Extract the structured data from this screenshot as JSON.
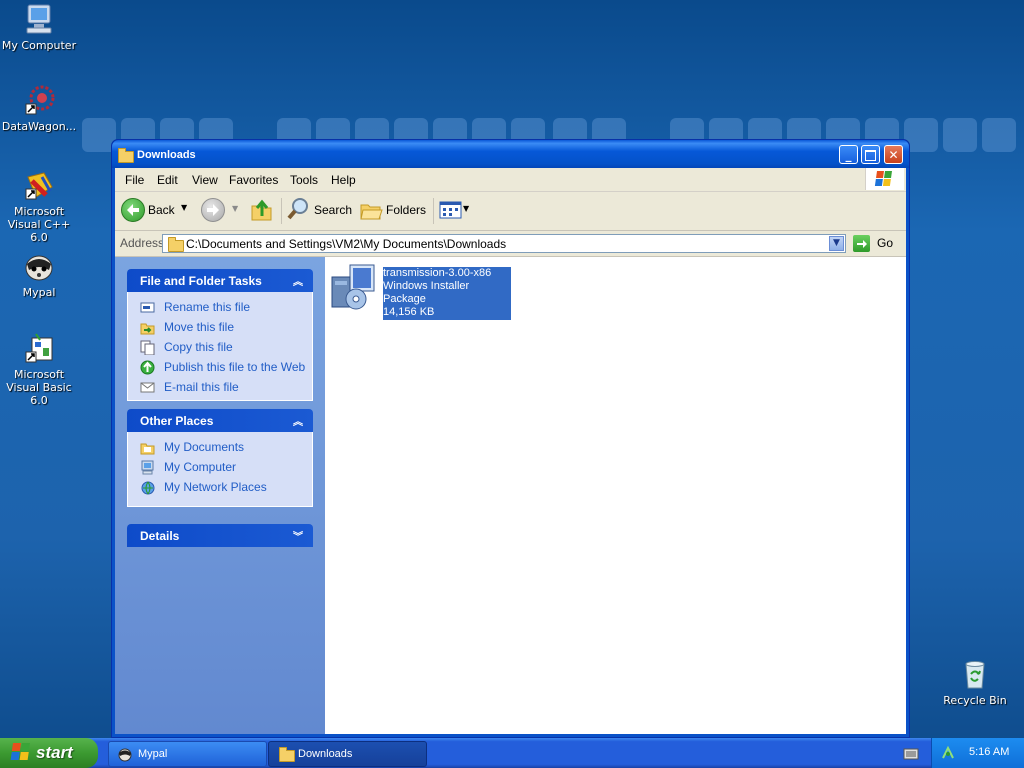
{
  "desktop": {
    "icons": [
      {
        "label": "My Computer"
      },
      {
        "label": "DataWagon..."
      },
      {
        "label": "Microsoft Visual C++ 6.0"
      },
      {
        "label": "Mypal"
      },
      {
        "label": "Microsoft Visual Basic 6.0"
      },
      {
        "label": "Recycle Bin"
      }
    ]
  },
  "window": {
    "title": "Downloads",
    "menu": [
      "File",
      "Edit",
      "View",
      "Favorites",
      "Tools",
      "Help"
    ],
    "toolbar": {
      "back": "Back",
      "search": "Search",
      "folders": "Folders"
    },
    "address": {
      "label": "Address",
      "value": "C:\\Documents and Settings\\VM2\\My Documents\\Downloads",
      "go": "Go"
    },
    "tasks_panel": {
      "title": "File and Folder Tasks",
      "items": [
        "Rename this file",
        "Move this file",
        "Copy this file",
        "Publish this file to the Web",
        "E-mail this file"
      ]
    },
    "places_panel": {
      "title": "Other Places",
      "items": [
        "My Documents",
        "My Computer",
        "My Network Places"
      ]
    },
    "details_panel": {
      "title": "Details"
    },
    "file": {
      "name": "transmission-3.00-x86",
      "type": "Windows Installer Package",
      "size": "14,156 KB"
    }
  },
  "taskbar": {
    "start": "start",
    "tasks": [
      "Mypal",
      "Downloads"
    ],
    "clock": "5:16 AM"
  },
  "colors": {
    "selection": "#316ac5",
    "title_blue": "#0452c9",
    "task_link": "#215dc6"
  }
}
